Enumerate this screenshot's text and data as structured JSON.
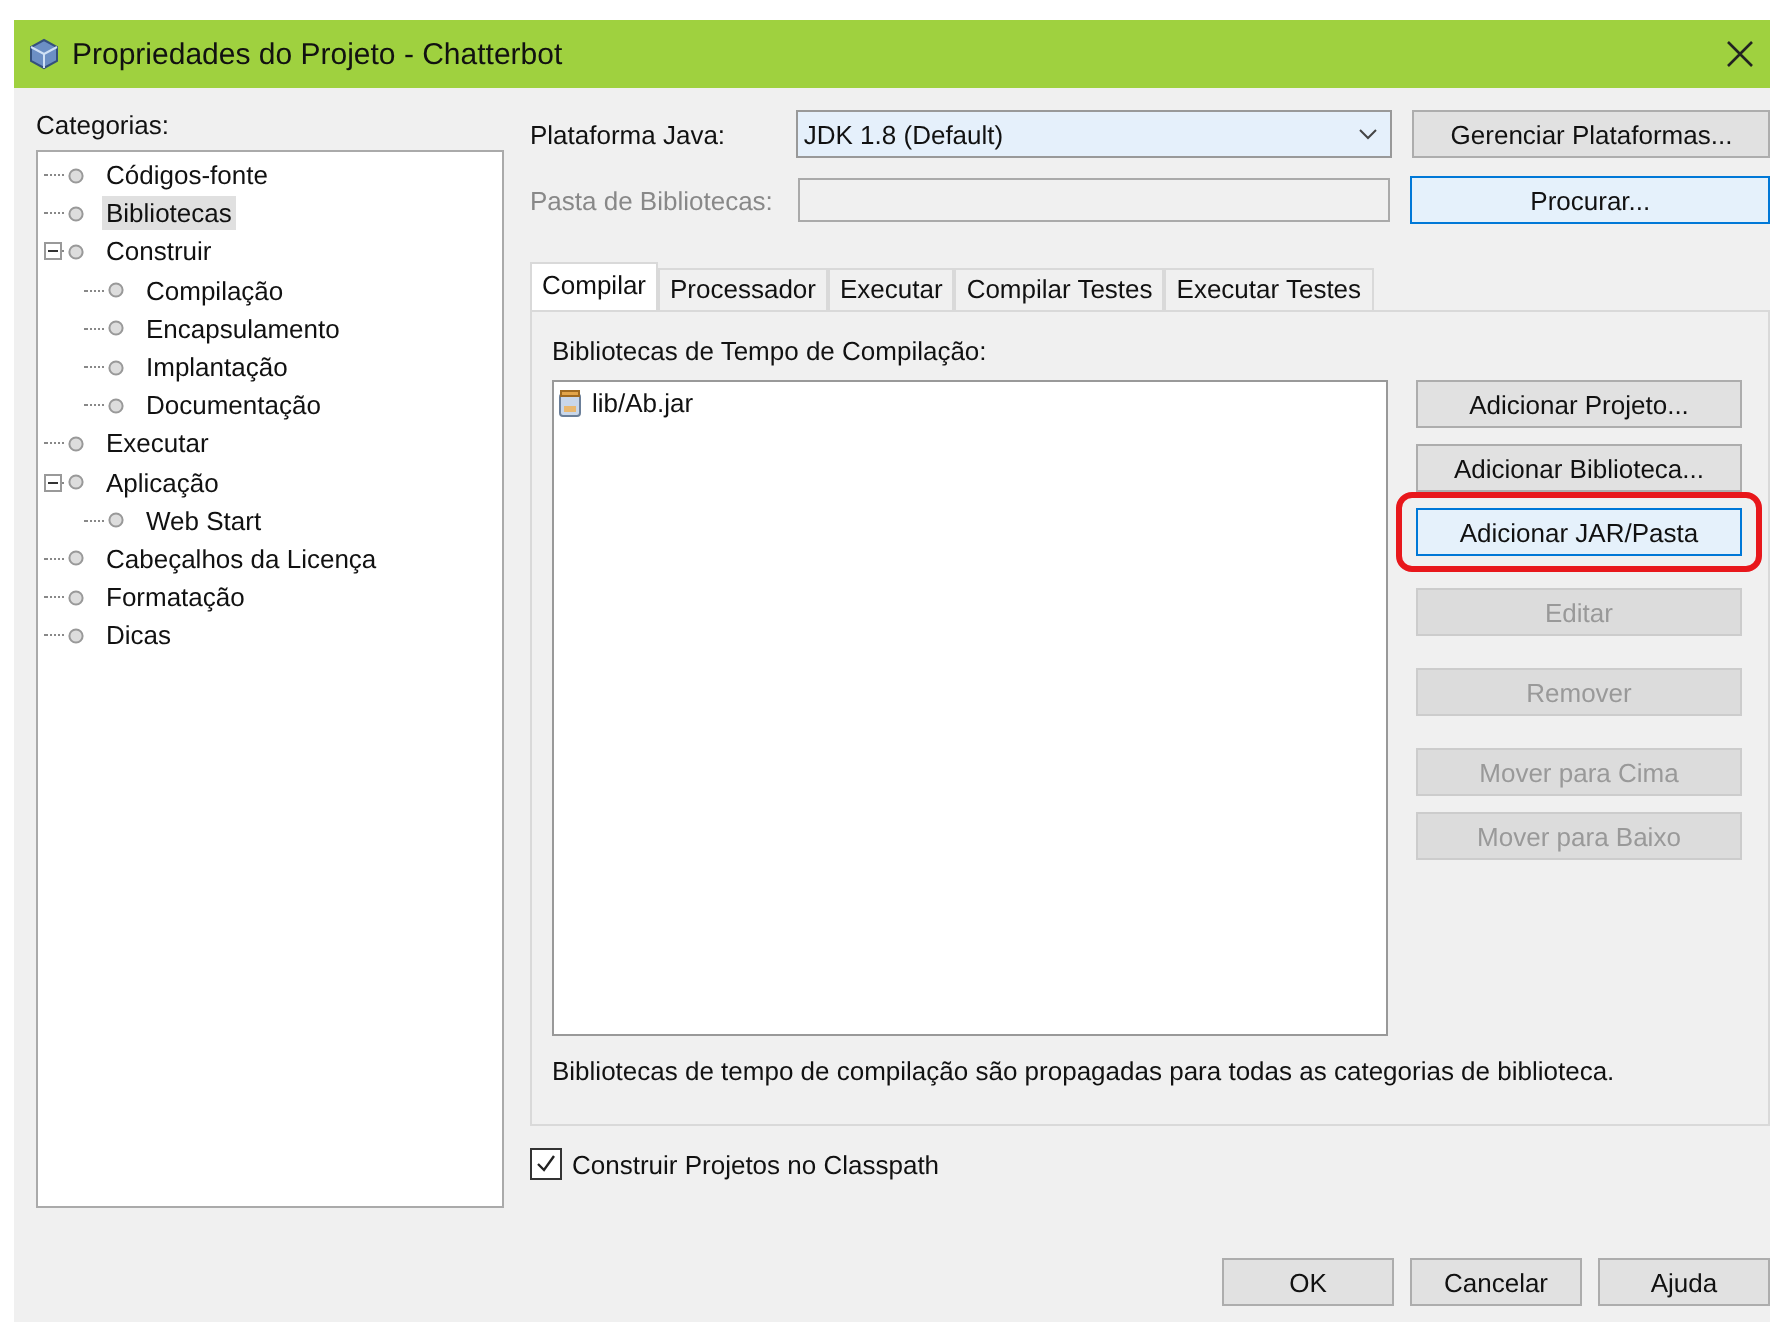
{
  "window": {
    "title": "Propriedades do Projeto - Chatterbot"
  },
  "categories": {
    "label": "Categorias:",
    "items": [
      {
        "label": "Códigos-fonte",
        "selected": false
      },
      {
        "label": "Bibliotecas",
        "selected": true
      },
      {
        "label": "Construir",
        "selected": false,
        "expanded": true,
        "children": [
          {
            "label": "Compilação",
            "selected": false
          },
          {
            "label": "Encapsulamento",
            "selected": false
          },
          {
            "label": "Implantação",
            "selected": false
          },
          {
            "label": "Documentação",
            "selected": false
          }
        ]
      },
      {
        "label": "Executar",
        "selected": false
      },
      {
        "label": "Aplicação",
        "selected": false,
        "expanded": true,
        "children": [
          {
            "label": "Web Start",
            "selected": false
          }
        ]
      },
      {
        "label": "Cabeçalhos da Licença",
        "selected": false
      },
      {
        "label": "Formatação",
        "selected": false
      },
      {
        "label": "Dicas",
        "selected": false
      }
    ]
  },
  "platform": {
    "label": "Plataforma Java:",
    "value": "JDK 1.8 (Default)",
    "button": "Gerenciar Plataformas..."
  },
  "library_folder": {
    "label": "Pasta de Bibliotecas:",
    "disabled": true,
    "button": "Procurar...",
    "button_focused": true
  },
  "tabs": [
    {
      "label": "Compilar",
      "selected": true
    },
    {
      "label": "Processador",
      "selected": false
    },
    {
      "label": "Executar",
      "selected": false
    },
    {
      "label": "Compilar Testes",
      "selected": false
    },
    {
      "label": "Executar Testes",
      "selected": false
    }
  ],
  "compile_libraries": {
    "label": "Bibliotecas de Tempo de Compilação:",
    "items": [
      "lib/Ab.jar"
    ],
    "note": "Bibliotecas de tempo de compilação são propagadas para todas as categorias de biblioteca."
  },
  "side_buttons": [
    {
      "label": "Adicionar Projeto...",
      "disabled": false,
      "focused": false,
      "highlighted": false
    },
    {
      "label": "Adicionar Biblioteca...",
      "disabled": false,
      "focused": false,
      "highlighted": false
    },
    {
      "label": "Adicionar JAR/Pasta",
      "disabled": false,
      "focused": true,
      "highlighted": true
    },
    {
      "label": "Editar",
      "disabled": true,
      "focused": false,
      "highlighted": false
    },
    {
      "label": "Remover",
      "disabled": true,
      "focused": false,
      "highlighted": false
    },
    {
      "label": "Mover para Cima",
      "disabled": true,
      "focused": false,
      "highlighted": false
    },
    {
      "label": "Mover para Baixo",
      "disabled": true,
      "focused": false,
      "highlighted": false
    }
  ],
  "build_projects": {
    "label": "Construir Projetos no Classpath",
    "checked": true
  },
  "footer_buttons": [
    "OK",
    "Cancelar",
    "Ajuda"
  ]
}
